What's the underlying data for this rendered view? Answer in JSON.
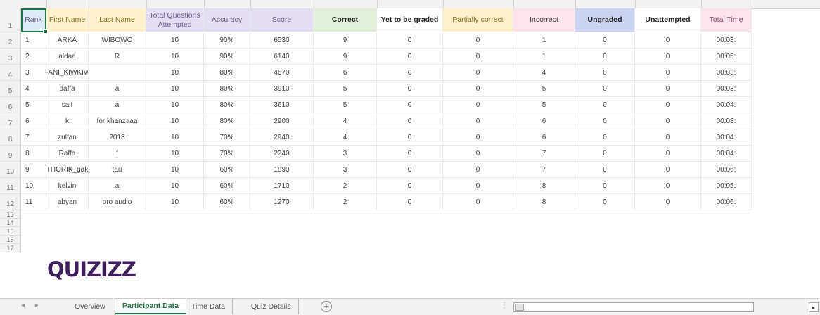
{
  "headers": [
    "Rank",
    "First Name",
    "Last Name",
    "Total Questions Attempted",
    "Accuracy",
    "Score",
    "Correct",
    "Yet to be graded",
    "Partially correct",
    "Incorrect",
    "Ungraded",
    "Unattempted",
    "Total Time"
  ],
  "rows": [
    {
      "num": "2",
      "cells": [
        "1",
        "ARKA",
        "WIBOWO",
        "10",
        "90%",
        "6530",
        "9",
        "0",
        "0",
        "1",
        "0",
        "0",
        "00:03:"
      ]
    },
    {
      "num": "3",
      "cells": [
        "2",
        "aldaa",
        "R",
        "10",
        "90%",
        "6140",
        "9",
        "0",
        "0",
        "1",
        "0",
        "0",
        "00:05:"
      ]
    },
    {
      "num": "4",
      "cells": [
        "3",
        "FANI_KIWKIW",
        "",
        "10",
        "80%",
        "4670",
        "6",
        "0",
        "0",
        "4",
        "0",
        "0",
        "00:03:"
      ]
    },
    {
      "num": "5",
      "cells": [
        "4",
        "daffa",
        "a",
        "10",
        "80%",
        "3910",
        "5",
        "0",
        "0",
        "5",
        "0",
        "0",
        "00:03:"
      ]
    },
    {
      "num": "6",
      "cells": [
        "5",
        "saif",
        "a",
        "10",
        "80%",
        "3610",
        "5",
        "0",
        "0",
        "5",
        "0",
        "0",
        "00:04:"
      ]
    },
    {
      "num": "7",
      "cells": [
        "6",
        "k",
        "for khanzaaa",
        "10",
        "80%",
        "2900",
        "4",
        "0",
        "0",
        "6",
        "0",
        "0",
        "00:03:"
      ]
    },
    {
      "num": "8",
      "cells": [
        "7",
        "zulfan",
        "2013",
        "10",
        "70%",
        "2940",
        "4",
        "0",
        "0",
        "6",
        "0",
        "0",
        "00:04:"
      ]
    },
    {
      "num": "9",
      "cells": [
        "8",
        "Raffa",
        "f",
        "10",
        "70%",
        "2240",
        "3",
        "0",
        "0",
        "7",
        "0",
        "0",
        "00:04:"
      ]
    },
    {
      "num": "10",
      "cells": [
        "9",
        "THORIK_gak",
        "tau",
        "10",
        "60%",
        "1890",
        "3",
        "0",
        "0",
        "7",
        "0",
        "0",
        "00:06:"
      ]
    },
    {
      "num": "11",
      "cells": [
        "10",
        "kelvin",
        "a",
        "10",
        "60%",
        "1710",
        "2",
        "0",
        "0",
        "8",
        "0",
        "0",
        "00:05:"
      ]
    },
    {
      "num": "12",
      "cells": [
        "11",
        "abyan",
        "pro audio",
        "10",
        "60%",
        "1270",
        "2",
        "0",
        "0",
        "8",
        "0",
        "0",
        "00:06:"
      ]
    }
  ],
  "empty_rows": [
    "13",
    "14",
    "15",
    "16",
    "17"
  ],
  "header_row_num": "1",
  "logo_text": "QUIZIZZ",
  "tabs": [
    "Overview",
    "Participant Data",
    "Time Data",
    "Quiz Details"
  ],
  "active_tab": "Participant Data",
  "add_sheet_symbol": "+",
  "colors": {
    "rank": "#ddebf7",
    "first_name": "#fff2cc",
    "last_name": "#fff2cc",
    "total_attempted": "#e4dff0",
    "accuracy": "#e4dff0",
    "score": "#e4dff0",
    "correct": "#e2efda",
    "yet_to_be_graded": "#ffffff",
    "partially_correct": "#fff2cc",
    "incorrect": "#fce4ec",
    "ungraded": "#c9d3ee",
    "unattempted": "#ffffff",
    "total_time": "#fce4ec",
    "accent": "#217346",
    "logo": "#3d1f5c"
  }
}
